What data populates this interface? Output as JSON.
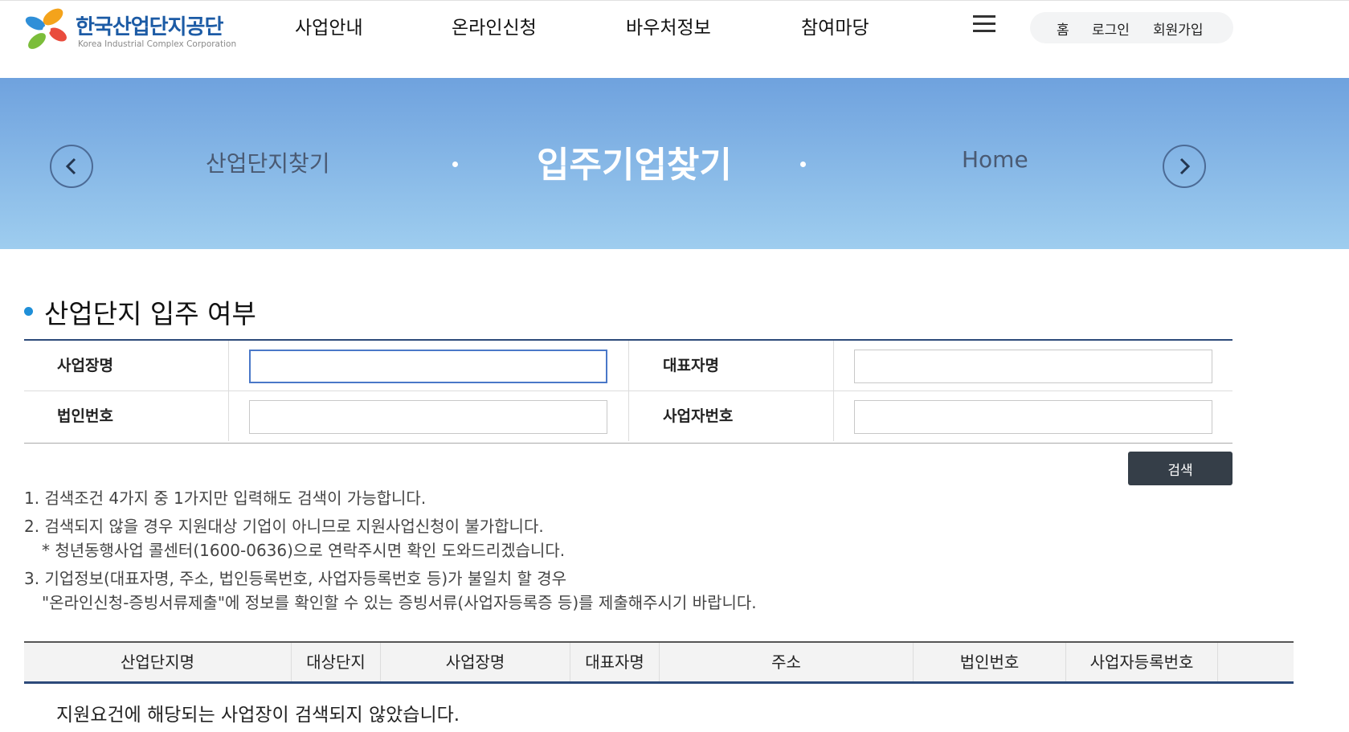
{
  "header": {
    "logo": {
      "title": "한국산업단지공단",
      "subtitle": "Korea Industrial Complex Corporation"
    },
    "gnb": [
      "사업안내",
      "온라인신청",
      "바우처정보",
      "참여마당"
    ],
    "util": [
      "홈",
      "로그인",
      "회원가입"
    ]
  },
  "banner": {
    "prev": "산업단지찾기",
    "current": "입주기업찾기",
    "next": "Home"
  },
  "section": {
    "title": "산업단지 입주 여부"
  },
  "form": {
    "business_name_label": "사업장명",
    "ceo_name_label": "대표자명",
    "corp_number_label": "법인번호",
    "biz_reg_number_label": "사업자번호",
    "business_name_value": "",
    "ceo_name_value": "",
    "corp_number_value": "",
    "biz_reg_number_value": "",
    "search_button": "검색"
  },
  "notes": [
    "1. 검색조건 4가지 중 1가지만 입력해도 검색이 가능합니다.",
    "2. 검색되지 않을 경우 지원대상 기업이 아니므로 지원사업신청이 불가합니다.",
    "* 청년동행사업 콜센터(1600-0636)으로 연락주시면 확인 도와드리겠습니다.",
    "3. 기업정보(대표자명, 주소, 법인등록번호, 사업자등록번호 등)가 불일치 할 경우",
    "\"온라인신청-증빙서류제출\"에 정보를 확인할 수 있는 증빙서류(사업자등록증 등)를 제출해주시기 바랍니다."
  ],
  "results": {
    "columns": [
      "산업단지명",
      "대상단지",
      "사업장명",
      "대표자명",
      "주소",
      "법인번호",
      "사업자등록번호"
    ],
    "empty_message": "지원요건에 해당되는 사업장이 검색되지 않았습니다."
  },
  "colors": {
    "brand": "#1c5ba5",
    "accent": "#1f8fd8",
    "table_border": "#2d4a7a",
    "button": "#353e48"
  }
}
